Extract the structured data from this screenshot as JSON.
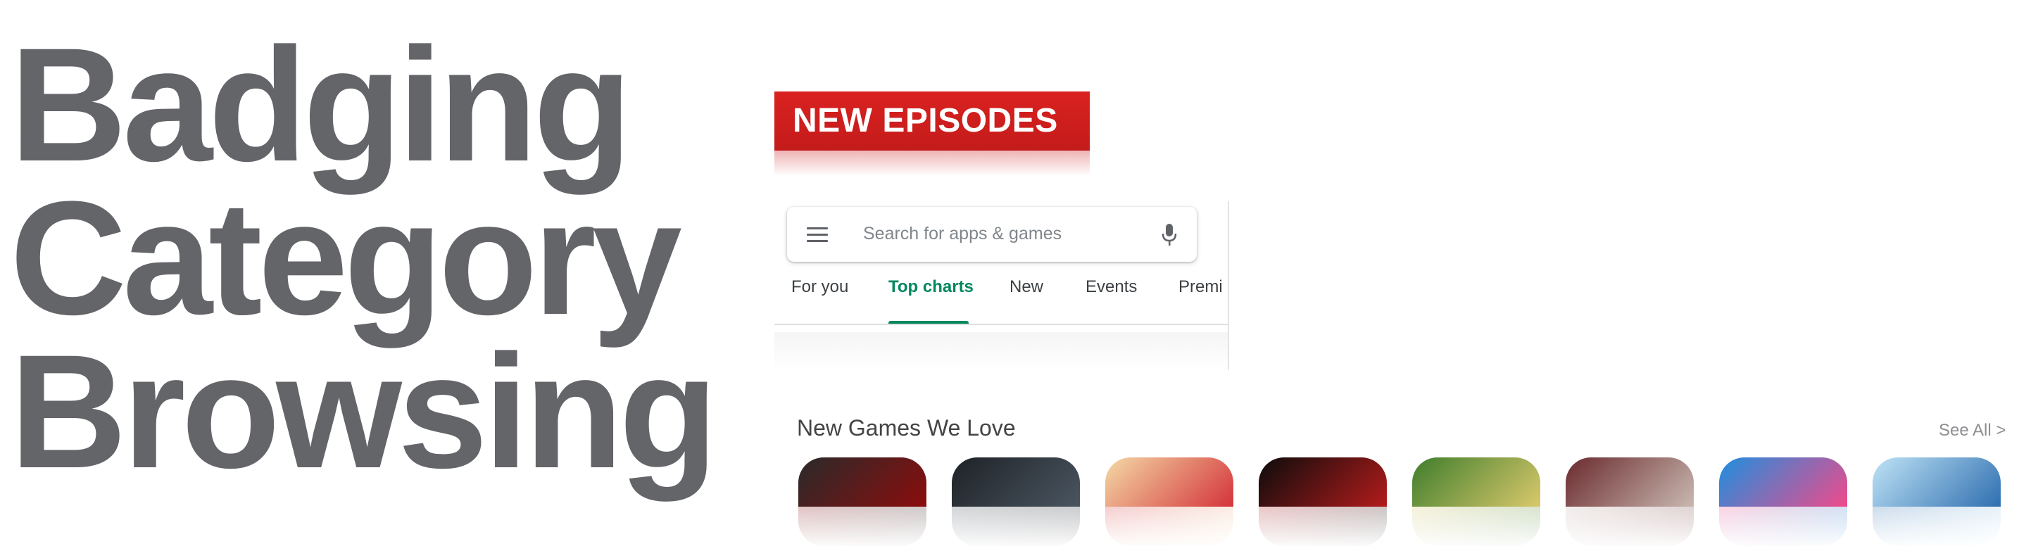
{
  "title_lines": [
    "Badging",
    "Category",
    "Browsing"
  ],
  "badge": {
    "label": "NEW EPISODES"
  },
  "play_store": {
    "search_placeholder": "Search for apps & games",
    "tabs": [
      {
        "label": "For you",
        "active": false
      },
      {
        "label": "Top charts",
        "active": true
      },
      {
        "label": "New",
        "active": false
      },
      {
        "label": "Events",
        "active": false
      },
      {
        "label": "Premi",
        "active": false
      }
    ],
    "accent_color": "#01875f"
  },
  "app_store": {
    "section_title": "New Games We Love",
    "see_all_label": "See All >",
    "game_icons": [
      {
        "name": "game-icon-1",
        "colors": [
          "#2a2a2a",
          "#8b0d0d"
        ]
      },
      {
        "name": "game-icon-2",
        "colors": [
          "#1e2227",
          "#4a5560"
        ]
      },
      {
        "name": "game-icon-3",
        "colors": [
          "#f4d9a6",
          "#d4343a"
        ]
      },
      {
        "name": "game-icon-4",
        "colors": [
          "#0c0c0c",
          "#b31b1b"
        ]
      },
      {
        "name": "game-icon-5",
        "colors": [
          "#3f7d2c",
          "#d9c86b"
        ]
      },
      {
        "name": "game-icon-6",
        "colors": [
          "#6a2a2e",
          "#c9b8b0"
        ]
      },
      {
        "name": "game-icon-7",
        "colors": [
          "#1d8fe0",
          "#f04a8a"
        ]
      },
      {
        "name": "game-icon-8",
        "colors": [
          "#bfe3f6",
          "#2f6fb0"
        ]
      }
    ]
  }
}
